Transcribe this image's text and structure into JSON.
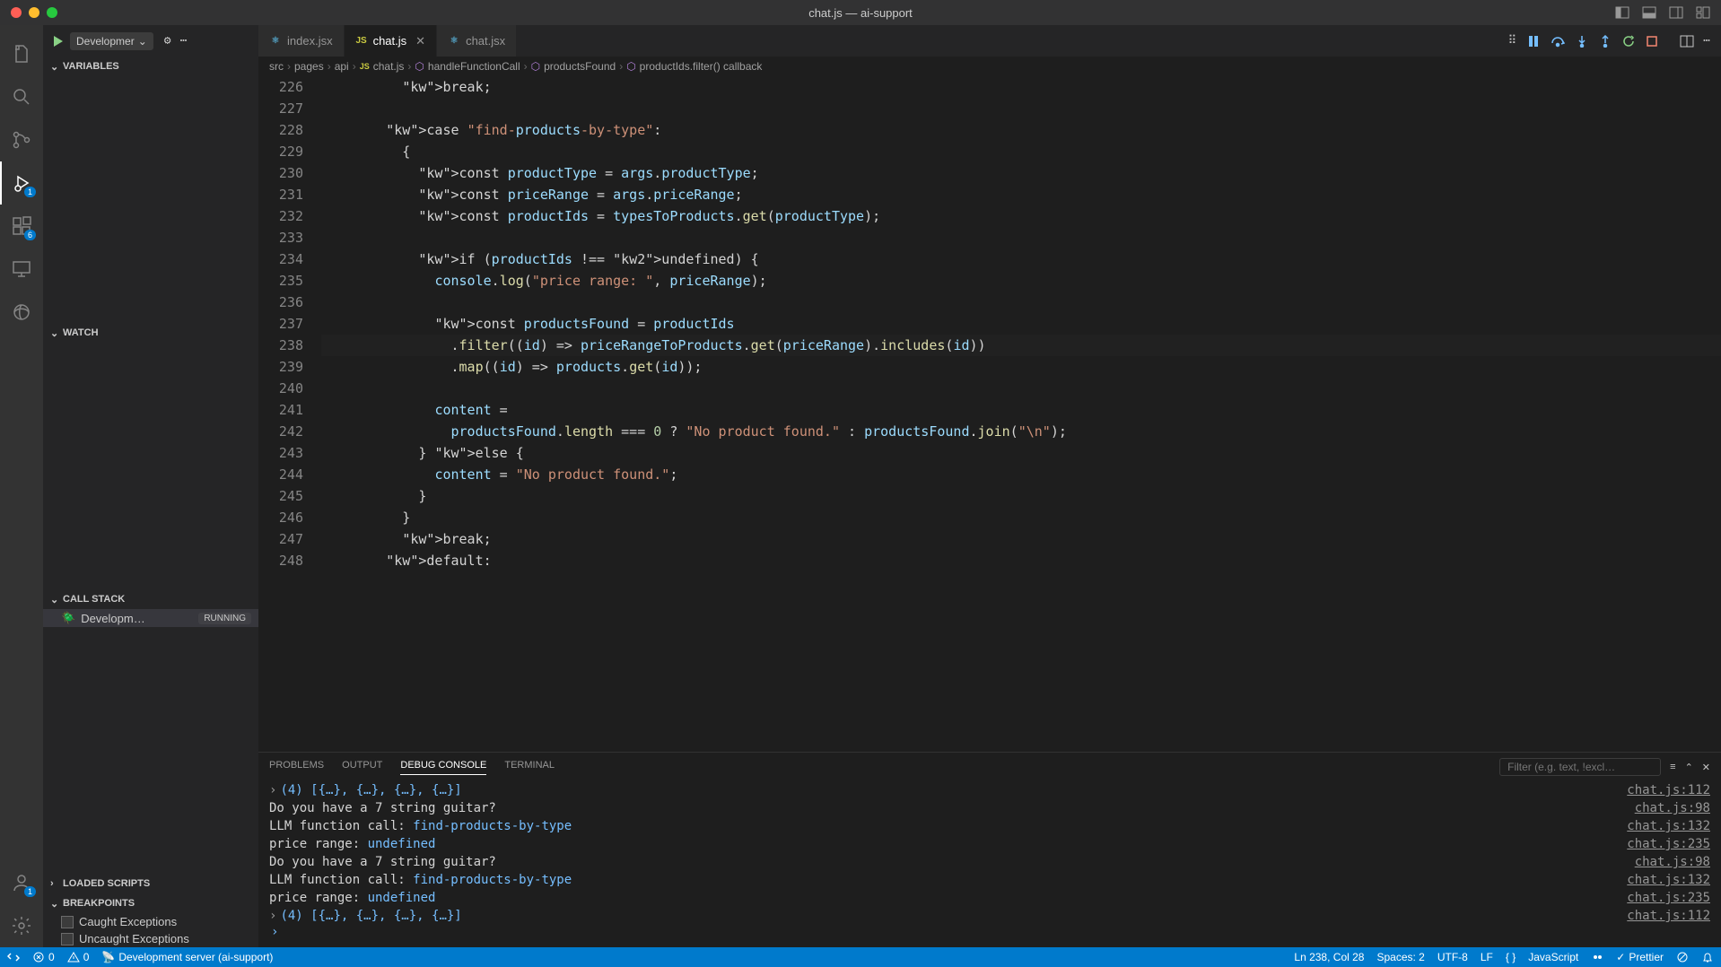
{
  "window": {
    "title": "chat.js — ai-support"
  },
  "activity": {
    "debug_badge": "1",
    "ext_badge": "6",
    "accounts_badge": "1"
  },
  "debug": {
    "config_label": "Developmer",
    "sections": {
      "variables": "VARIABLES",
      "watch": "WATCH",
      "callstack": "CALL STACK",
      "loaded": "LOADED SCRIPTS",
      "breakpoints": "BREAKPOINTS"
    },
    "callstack_item": "Developm…",
    "running": "RUNNING",
    "bp_caught": "Caught Exceptions",
    "bp_uncaught": "Uncaught Exceptions"
  },
  "tabs": [
    {
      "label": "index.jsx",
      "icon": "react",
      "active": false
    },
    {
      "label": "chat.js",
      "icon": "js",
      "active": true
    },
    {
      "label": "chat.jsx",
      "icon": "react",
      "active": false
    }
  ],
  "breadcrumbs": [
    "src",
    "pages",
    "api",
    "chat.js",
    "handleFunctionCall",
    "productsFound",
    "productIds.filter() callback"
  ],
  "code": {
    "start": 226,
    "lines": [
      "          break;",
      "",
      "        case \"find-products-by-type\":",
      "          {",
      "            const productType = args.productType;",
      "            const priceRange = args.priceRange;",
      "            const productIds = typesToProducts.get(productType);",
      "",
      "            if (productIds !== undefined) {",
      "              console.log(\"price range: \", priceRange);",
      "",
      "              const productsFound = productIds",
      "                .filter((id) => priceRangeToProducts.get(priceRange).includes(id))",
      "                .map((id) => products.get(id));",
      "",
      "              content =",
      "                productsFound.length === 0 ? \"No product found.\" : productsFound.join(\"\\n\");",
      "            } else {",
      "              content = \"No product found.\";",
      "            }",
      "          }",
      "          break;",
      "        default:"
    ]
  },
  "panel": {
    "tabs": {
      "problems": "PROBLEMS",
      "output": "OUTPUT",
      "debug": "DEBUG CONSOLE",
      "terminal": "TERMINAL"
    },
    "filter_placeholder": "Filter (e.g. text, !excl…",
    "lines": [
      {
        "prefix": "›",
        "text": "(4) [{…}, {…}, {…}, {…}]",
        "blue": true,
        "link": "chat.js:112"
      },
      {
        "text": "Do you have a 7 string guitar?",
        "link": "chat.js:98"
      },
      {
        "text": "LLM function call:  find-products-by-type",
        "blue_tail": "find-products-by-type",
        "link": "chat.js:132"
      },
      {
        "text": "price range:  undefined",
        "blue_tail": "undefined",
        "link": "chat.js:235"
      },
      {
        "text": "Do you have a 7 string guitar?",
        "link": "chat.js:98"
      },
      {
        "text": "LLM function call:  find-products-by-type",
        "blue_tail": "find-products-by-type",
        "link": "chat.js:132"
      },
      {
        "text": "price range:  undefined",
        "blue_tail": "undefined",
        "link": "chat.js:235"
      },
      {
        "prefix": "›",
        "text": "(4) [{…}, {…}, {…}, {…}]",
        "blue": true,
        "link": "chat.js:112"
      }
    ]
  },
  "status": {
    "errors": "0",
    "warnings": "0",
    "server": "Development server (ai-support)",
    "pos": "Ln 238, Col 28",
    "spaces": "Spaces: 2",
    "encoding": "UTF-8",
    "eol": "LF",
    "lang": "JavaScript",
    "prettier": "Prettier"
  }
}
